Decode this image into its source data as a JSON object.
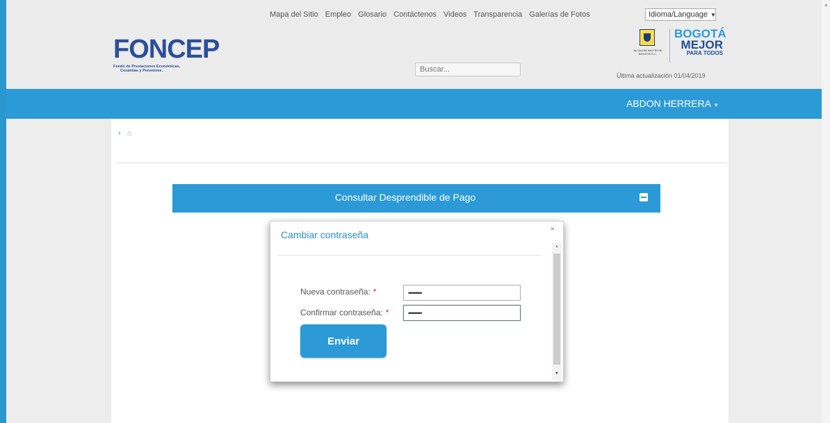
{
  "topnav": {
    "links": [
      "Mapa del Sitio",
      "Empleo",
      "Glosario",
      "Contáctenos",
      "Videos",
      "Transparencia",
      "Galerías de Fotos"
    ],
    "language": "Idioma/Language"
  },
  "logo": {
    "name": "FONCEP",
    "subtitle_line1": "Fondo de Prestaciones Económicas,",
    "subtitle_line2": "Cesantías y Pensiones."
  },
  "search": {
    "placeholder": "Buscar..."
  },
  "partner": {
    "crest_text": "ALCALDÍA MAYOR DE BOGOTÁ D.C.",
    "line1": "BOGOTÁ",
    "line2": "MEJOR",
    "line3": "PARA TODOS"
  },
  "updated": "Última actualización 01/04/2019",
  "user": {
    "name": "ABDON HERRERA"
  },
  "panel": {
    "title": "Consultar Desprendible de Pago"
  },
  "modal": {
    "title": "Cambiar contraseña",
    "close": "×",
    "new_label": "Nueva contraseña:",
    "confirm_label": "Confirmar contraseña:",
    "required_mark": "*",
    "new_value": "•••••••••",
    "confirm_value": "•••••••••",
    "submit": "Enviar"
  },
  "colors": {
    "accent": "#2b9ad6",
    "brand": "#2a4f9b"
  }
}
